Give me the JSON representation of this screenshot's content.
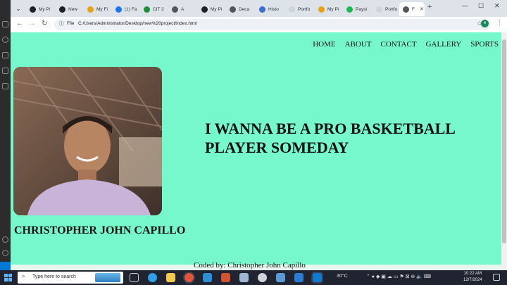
{
  "browser": {
    "tabs": [
      {
        "label": "My Pi",
        "fav": "#202124"
      },
      {
        "label": "New",
        "fav": "#202124"
      },
      {
        "label": "My Fi",
        "fav": "#e8a317"
      },
      {
        "label": "(1) Fa",
        "fav": "#1877f2"
      },
      {
        "label": "CIT 2",
        "fav": "#1e8e3e"
      },
      {
        "label": "A",
        "fav": "#555555"
      },
      {
        "label": "My Pi",
        "fav": "#202124"
      },
      {
        "label": "Deca",
        "fav": "#555555"
      },
      {
        "label": "Histo",
        "fav": "#3b6fd1"
      },
      {
        "label": "Portfo",
        "fav": "#cfd5dc"
      },
      {
        "label": "My Pi",
        "fav": "#e8a317"
      },
      {
        "label": "Paysl",
        "fav": "#1db954"
      },
      {
        "label": "Portfo",
        "fav": "#cfd5dc"
      },
      {
        "label": "F",
        "fav": "#555555"
      }
    ],
    "new_tab": "+",
    "window_controls": {
      "minimize": "—",
      "maximize": "☐",
      "close": "✕"
    },
    "toolbar": {
      "back": "←",
      "forward": "→",
      "reload": "↻",
      "info_icon": "ⓘ",
      "file_chip": "File",
      "url": "C:/Users/Administrator/Desktop/new%20project/index.html",
      "star": "☆",
      "profile": "e",
      "menu": "⋮"
    }
  },
  "page": {
    "nav": [
      "HOME",
      "ABOUT",
      "CONTACT",
      "GALLERY",
      "SPORTS"
    ],
    "tagline": "I WANNA BE A PRO BASKETBALL PLAYER SOMEDAY",
    "name": "CHRISTOPHER JOHN CAPILLO",
    "footer": "Coded by: Christopher John Capillo",
    "bg_color": "#76f7cc"
  },
  "taskbar": {
    "search_placeholder": "Type here to search",
    "weather": "30°C",
    "clock_time": "10:22 AM",
    "clock_date": "12/7/2024"
  }
}
